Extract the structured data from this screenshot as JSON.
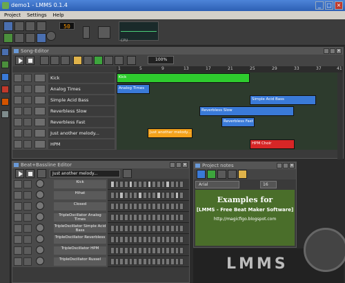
{
  "app": {
    "title": "demo1 - LMMS 0.1.4"
  },
  "menu": [
    "Project",
    "Settings",
    "Help"
  ],
  "toolbar": {
    "tempo": "50",
    "cpu_label": "CPU"
  },
  "song_editor": {
    "title": "Song-Editor",
    "zoom": "100%",
    "ticks": [
      "1",
      "5",
      "9",
      "13",
      "17",
      "21",
      "25",
      "29",
      "33",
      "37",
      "41"
    ],
    "tracks": [
      {
        "name": "Kick",
        "segment": {
          "label": "Kick",
          "color": "#2ecc2e"
        }
      },
      {
        "name": "Analog Times",
        "segment": {
          "label": "Analog Times",
          "color": "#3a7ad8"
        }
      },
      {
        "name": "Simple Acid Bass",
        "segment": {
          "label": "Simple Acid Bass",
          "color": "#3a7ad8"
        }
      },
      {
        "name": "Reverbless Slow",
        "segment": {
          "label": "Reverbless Slow",
          "color": "#3a7ad8"
        }
      },
      {
        "name": "Reverbless Fast",
        "segment": {
          "label": "Reverbless Fast",
          "color": "#3a7ad8"
        }
      },
      {
        "name": "Just another melody...",
        "segment": {
          "label": "Just another melody...",
          "color": "#f4a21b"
        }
      },
      {
        "name": "HPM",
        "segment": {
          "label": "HPM Choir",
          "color": "#d72626"
        }
      }
    ]
  },
  "bb_editor": {
    "title": "Beat+Bassline Editor",
    "selected": "Just another melody...",
    "rows": [
      {
        "name": "Kick"
      },
      {
        "name": "Hihat"
      },
      {
        "name": "Closed"
      },
      {
        "name": "TripleOscillator\nAnalog Times"
      },
      {
        "name": "TripleOscillator\nSimple Acid Bass"
      },
      {
        "name": "TripleOscillator\nReverbless"
      },
      {
        "name": "TripleOscillator\nHPM"
      },
      {
        "name": "TripleOscillator\nRussel"
      }
    ]
  },
  "notes": {
    "title": "Project notes",
    "font": "Arial",
    "size": "16",
    "line1": "Examples for",
    "line2": "[LMMS - Free Beat Maker Software]",
    "line3": "http://magicfigo.blogspot.com"
  },
  "logo": {
    "text": "LMMS"
  }
}
